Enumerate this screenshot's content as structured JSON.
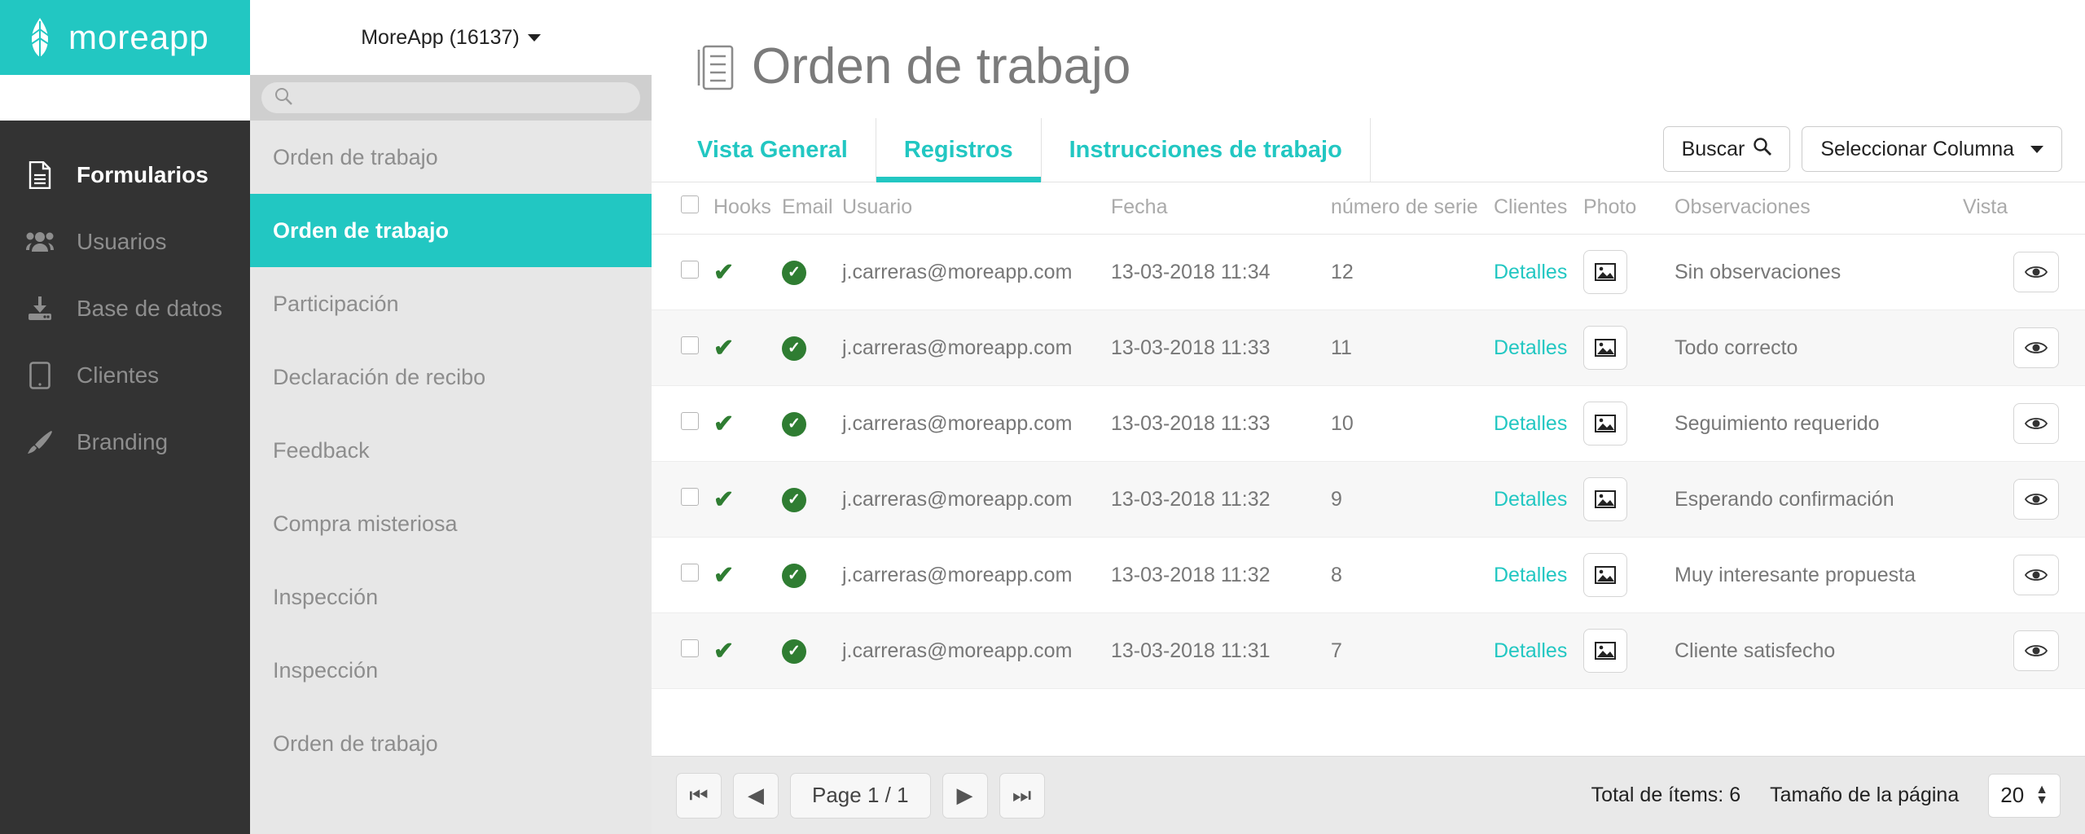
{
  "brand": {
    "name": "moreapp",
    "logo_icon": "leaf-icon"
  },
  "account": {
    "label": "MoreApp (16137)",
    "caret_icon": "chevron-down-icon"
  },
  "sidebar": {
    "items": [
      {
        "label": "Formularios",
        "icon": "document-icon",
        "active": true
      },
      {
        "label": "Usuarios",
        "icon": "users-icon",
        "active": false
      },
      {
        "label": "Base de datos",
        "icon": "database-download-icon",
        "active": false
      },
      {
        "label": "Clientes",
        "icon": "tablet-icon",
        "active": false
      },
      {
        "label": "Branding",
        "icon": "paintbrush-icon",
        "active": false
      }
    ]
  },
  "form_panel": {
    "search": {
      "placeholder": "",
      "value": "",
      "icon": "search-icon"
    },
    "items": [
      {
        "label": "Orden de trabajo",
        "selected": false
      },
      {
        "label": "Orden de trabajo",
        "selected": true
      },
      {
        "label": "Participación",
        "selected": false
      },
      {
        "label": "Declaración de recibo",
        "selected": false
      },
      {
        "label": "Feedback",
        "selected": false
      },
      {
        "label": "Compra misteriosa",
        "selected": false
      },
      {
        "label": "Inspección",
        "selected": false
      },
      {
        "label": "Inspección",
        "selected": false
      },
      {
        "label": "Orden de trabajo",
        "selected": false
      }
    ]
  },
  "page": {
    "title": "Orden de trabajo",
    "title_icon": "document-lines-icon"
  },
  "tabs": [
    {
      "label": "Vista General",
      "active": false
    },
    {
      "label": "Registros",
      "active": true
    },
    {
      "label": "Instrucciones de trabajo",
      "active": false
    }
  ],
  "toolbar": {
    "search_label": "Buscar",
    "search_icon": "search-icon",
    "columns_label": "Seleccionar Columna",
    "columns_caret_icon": "chevron-down-icon"
  },
  "table": {
    "columns": [
      "",
      "Hooks",
      "Email",
      "Usuario",
      "Fecha",
      "número de serie",
      "Clientes",
      "Photo",
      "Observaciones",
      "Vista"
    ],
    "rows": [
      {
        "hooks": "✔",
        "email": "✔",
        "usuario": "j.carreras@moreapp.com",
        "fecha": "13-03-2018 11:34",
        "serie": "12",
        "clientes": "Detalles",
        "photo": "image-icon",
        "observaciones": "Sin observaciones",
        "vista": "eye-icon"
      },
      {
        "hooks": "✔",
        "email": "✔",
        "usuario": "j.carreras@moreapp.com",
        "fecha": "13-03-2018 11:33",
        "serie": "11",
        "clientes": "Detalles",
        "photo": "image-icon",
        "observaciones": "Todo correcto",
        "vista": "eye-icon"
      },
      {
        "hooks": "✔",
        "email": "✔",
        "usuario": "j.carreras@moreapp.com",
        "fecha": "13-03-2018 11:33",
        "serie": "10",
        "clientes": "Detalles",
        "photo": "image-icon",
        "observaciones": "Seguimiento requerido",
        "vista": "eye-icon"
      },
      {
        "hooks": "✔",
        "email": "✔",
        "usuario": "j.carreras@moreapp.com",
        "fecha": "13-03-2018 11:32",
        "serie": "9",
        "clientes": "Detalles",
        "photo": "image-icon",
        "observaciones": "Esperando confirmación",
        "vista": "eye-icon"
      },
      {
        "hooks": "✔",
        "email": "✔",
        "usuario": "j.carreras@moreapp.com",
        "fecha": "13-03-2018 11:32",
        "serie": "8",
        "clientes": "Detalles",
        "photo": "image-icon",
        "observaciones": "Muy interesante propuesta",
        "vista": "eye-icon"
      },
      {
        "hooks": "✔",
        "email": "✔",
        "usuario": "j.carreras@moreapp.com",
        "fecha": "13-03-2018 11:31",
        "serie": "7",
        "clientes": "Detalles",
        "photo": "image-icon",
        "observaciones": "Cliente satisfecho",
        "vista": "eye-icon"
      }
    ]
  },
  "pagination": {
    "first_icon": "first-page-icon",
    "prev_icon": "prev-page-icon",
    "page_label": "Page 1 / 1",
    "next_icon": "next-page-icon",
    "last_icon": "last-page-icon",
    "total_label": "Total de ítems: 6",
    "page_size_label": "Tamaño de la página",
    "page_size_value": "20"
  },
  "colors": {
    "accent": "#22c7c2",
    "sidebar_bg": "#333333",
    "panel_bg": "#e7e7e7",
    "success": "#2f7d32"
  }
}
